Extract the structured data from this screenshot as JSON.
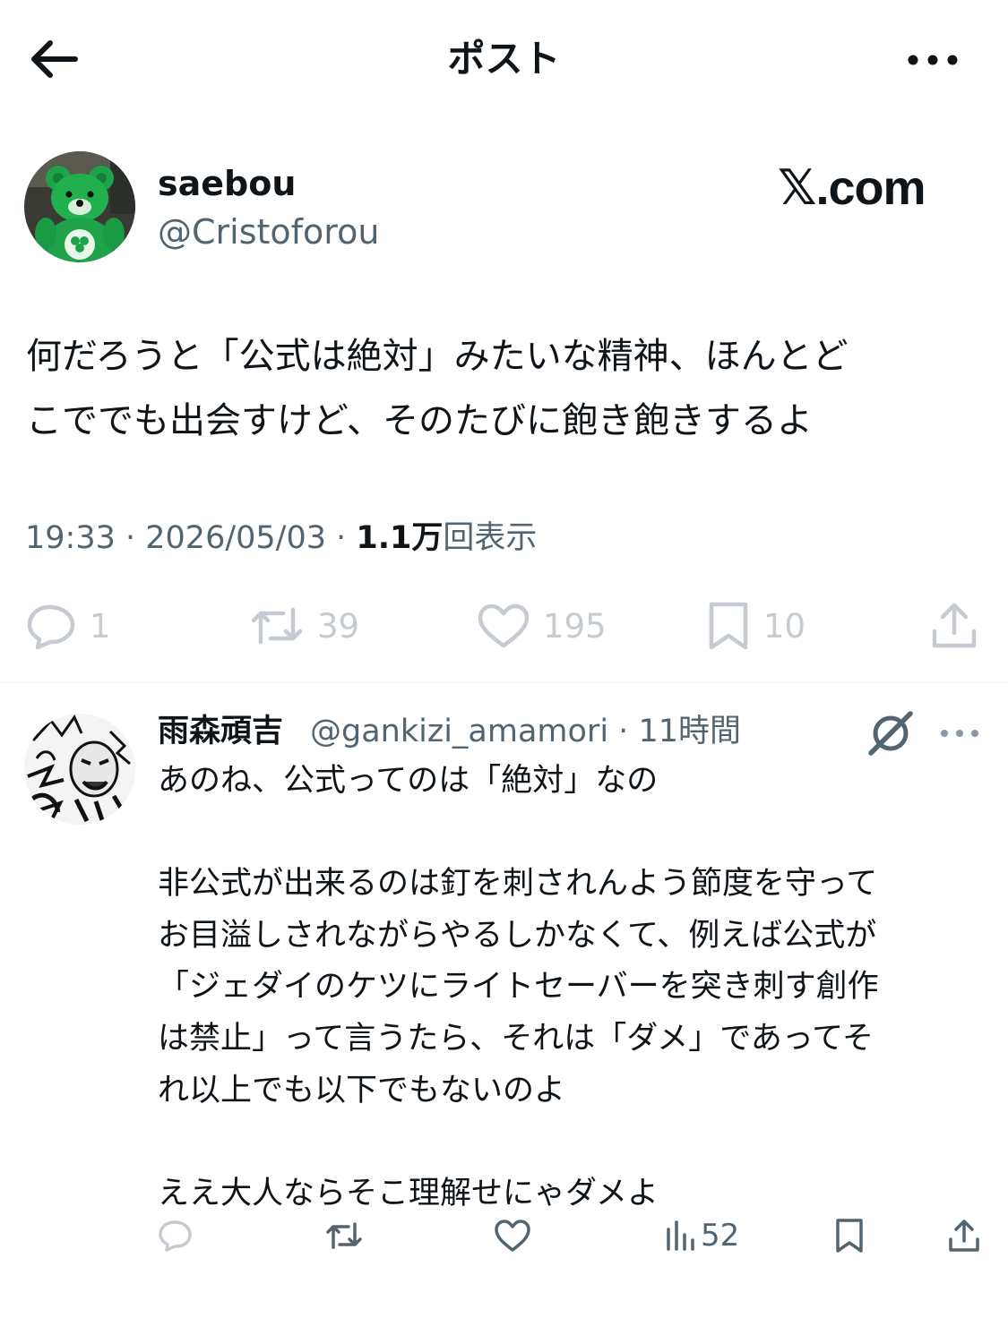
{
  "header": {
    "title": "ポスト",
    "back_icon": "arrow-left-icon",
    "more_icon": "more-horizontal-icon"
  },
  "post": {
    "author": {
      "display_name": "saebou",
      "handle": "@Cristoforou"
    },
    "watermark": "𝕏.com",
    "text": "何だろうと「公式は絶対」みたいな精神、ほんとど\nこででも出会すけど、そのたびに飽き飽きするよ",
    "time": "19:33",
    "date": "2026/05/03",
    "views_count": "1.1万",
    "views_label": "回表示",
    "actions": {
      "reply_count": "1",
      "repost_count": "39",
      "like_count": "195",
      "bookmark_count": "10"
    }
  },
  "reply": {
    "display_name": "雨森頑吉",
    "handle": "@gankizi_amamori",
    "time_ago": "11時間",
    "text": "あのね、公式ってのは「絶対」なの\n\n非公式が出来るのは釘を刺されんよう節度を守って\nお目溢しされながらやるしかなくて、例えば公式が\n「ジェダイのケツにライトセーバーを突き刺す創作\nは禁止」って言うたら、それは「ダメ」であってそ\nれ以上でも以下でもないのよ\n\nええ大人ならそこ理解せにゃダメよ",
    "views_count": "52"
  },
  "colors": {
    "text_primary": "#0f1419",
    "text_secondary": "#536471",
    "icon_faded": "#c5cbd0",
    "divider": "#eff3f4",
    "avatar_green": "#1fa34a"
  }
}
